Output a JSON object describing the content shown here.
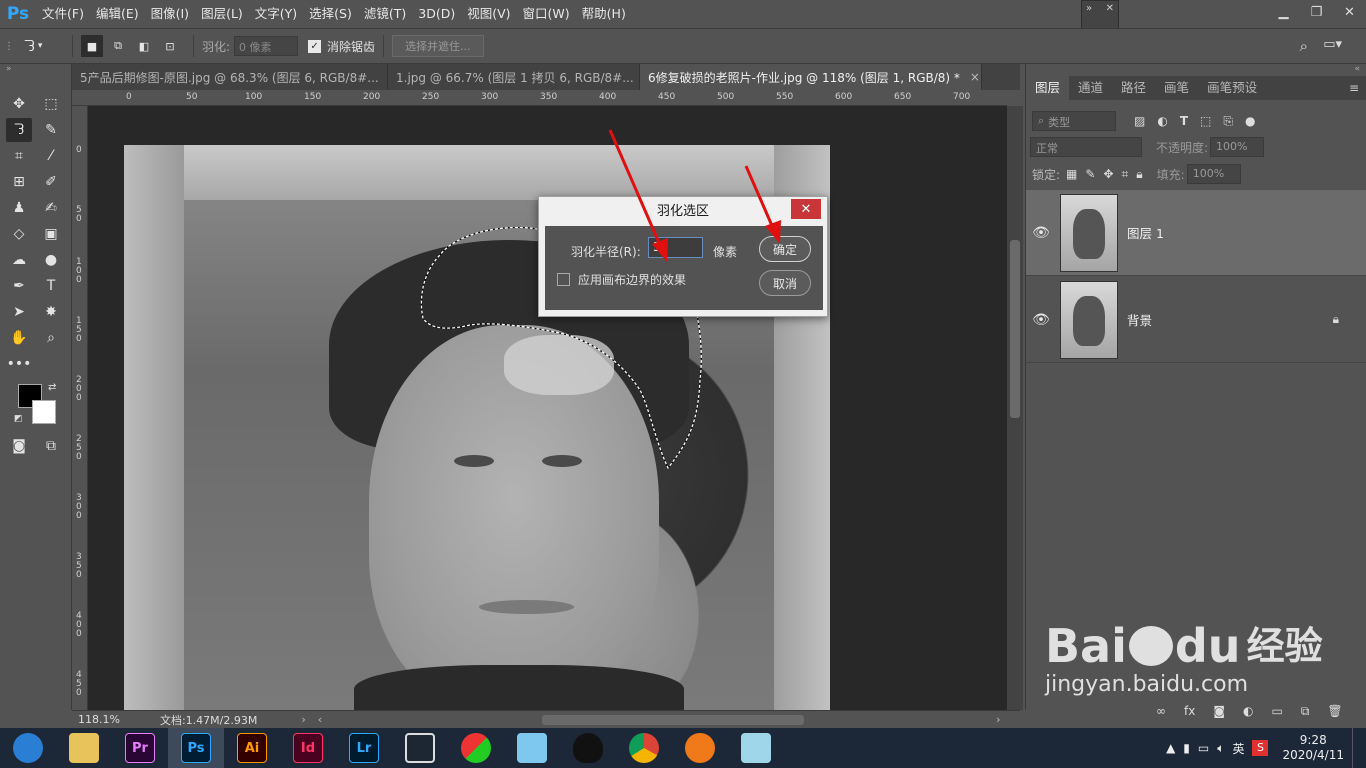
{
  "app": {
    "logo": "Ps"
  },
  "menu": [
    "文件(F)",
    "编辑(E)",
    "图像(I)",
    "图层(L)",
    "文字(Y)",
    "选择(S)",
    "滤镜(T)",
    "3D(D)",
    "视图(V)",
    "窗口(W)",
    "帮助(H)"
  ],
  "options": {
    "feather_label": "羽化:",
    "feather_value": "0 像素",
    "antialias_label": "消除锯齿",
    "select_mask_label": "选择并遮住..."
  },
  "tabs": [
    {
      "label": "5产品后期修图-原图.jpg @ 68.3% (图层 6, RGB/8#...",
      "close": "×"
    },
    {
      "label": "1.jpg @ 66.7% (图层 1 拷贝 6, RGB/8#...",
      "close": "×"
    },
    {
      "label": "6修复破损的老照片-作业.jpg @ 118% (图层 1, RGB/8) *",
      "close": "×"
    }
  ],
  "ruler": {
    "h_ticks": [
      "0",
      "50",
      "100",
      "150",
      "200",
      "250",
      "300",
      "350",
      "400",
      "450",
      "500",
      "550",
      "600",
      "650",
      "700"
    ],
    "v_ticks": [
      "0",
      "5\n0",
      "1\n0\n0",
      "1\n5\n0",
      "2\n0\n0",
      "2\n5\n0",
      "3\n0\n0",
      "3\n5\n0",
      "4\n0\n0",
      "4\n5\n0"
    ]
  },
  "dialog": {
    "title": "羽化选区",
    "close": "✕",
    "radius_label": "羽化半径(R):",
    "radius_value": "5",
    "unit": "像素",
    "apply_canvas_label": "应用画布边界的效果",
    "ok_label": "确定",
    "cancel_label": "取消"
  },
  "layers_panel": {
    "tabs": [
      "图层",
      "通道",
      "路径",
      "画笔",
      "画笔预设"
    ],
    "filter_label": "类型",
    "blend_mode": "正常",
    "opacity_label": "不透明度:",
    "opacity_value": "100%",
    "lock_label": "锁定:",
    "fill_label": "填充:",
    "fill_value": "100%",
    "layers": [
      {
        "name": "图层 1",
        "visible": true,
        "selected": true
      },
      {
        "name": "背景",
        "visible": true,
        "locked": true
      }
    ]
  },
  "status": {
    "zoom": "118.1%",
    "doc": "文档:1.47M/2.93M"
  },
  "taskbar": {
    "apps": [
      {
        "name": "Pr",
        "color": "#2a0634",
        "fg": "#e67cf9"
      },
      {
        "name": "Ps",
        "color": "#001d34",
        "fg": "#31a8ff"
      },
      {
        "name": "Ai",
        "color": "#330000",
        "fg": "#ff9a00"
      },
      {
        "name": "Id",
        "color": "#49021f",
        "fg": "#ff3366"
      },
      {
        "name": "Lr",
        "color": "#001a2e",
        "fg": "#31a8ff"
      }
    ],
    "ime": "英",
    "time": "9:28",
    "date": "2020/4/11"
  },
  "watermark": {
    "brand": "Bai",
    "brand2": "du",
    "cn": "经验",
    "url": "jingyan.baidu.com"
  },
  "colors": {
    "accent_blue": "#31a8ff",
    "dialog_close": "#c8363a",
    "arrow_red": "#e01010"
  }
}
